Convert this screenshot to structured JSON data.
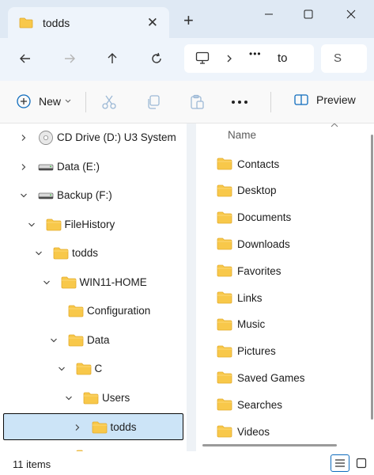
{
  "tab": {
    "title": "todds"
  },
  "address": {
    "ellipsis": "•••",
    "crumb": "to",
    "search_partial": "S"
  },
  "toolbar": {
    "new_label": "New",
    "preview_label": "Preview"
  },
  "tree": [
    {
      "label": "CD Drive (D:) U3 System",
      "icon": "cd-drive-icon",
      "chevron": "right"
    },
    {
      "label": "Data (E:)",
      "icon": "drive-icon",
      "chevron": "right"
    },
    {
      "label": "Backup (F:)",
      "icon": "drive-icon",
      "chevron": "down"
    },
    {
      "label": "FileHistory",
      "icon": "folder-icon",
      "chevron": "down"
    },
    {
      "label": "todds",
      "icon": "folder-icon",
      "chevron": "down"
    },
    {
      "label": "WIN11-HOME",
      "icon": "folder-icon",
      "chevron": "down"
    },
    {
      "label": "Configuration",
      "icon": "folder-icon",
      "chevron": "none"
    },
    {
      "label": "Data",
      "icon": "folder-icon",
      "chevron": "down"
    },
    {
      "label": "C",
      "icon": "folder-icon",
      "chevron": "down"
    },
    {
      "label": "Users",
      "icon": "folder-icon",
      "chevron": "down"
    },
    {
      "label": "todds",
      "icon": "folder-icon",
      "chevron": "right",
      "selected": true
    }
  ],
  "list": {
    "column_name": "Name",
    "items": [
      "Contacts",
      "Desktop",
      "Documents",
      "Downloads",
      "Favorites",
      "Links",
      "Music",
      "Pictures",
      "Saved Games",
      "Searches",
      "Videos"
    ]
  },
  "status": {
    "item_count": "11 items"
  },
  "colors": {
    "accent": "#0f6cbd",
    "folder": "#f8c84a",
    "selection": "#cce4f7",
    "titlebar": "#dfe9f4"
  }
}
